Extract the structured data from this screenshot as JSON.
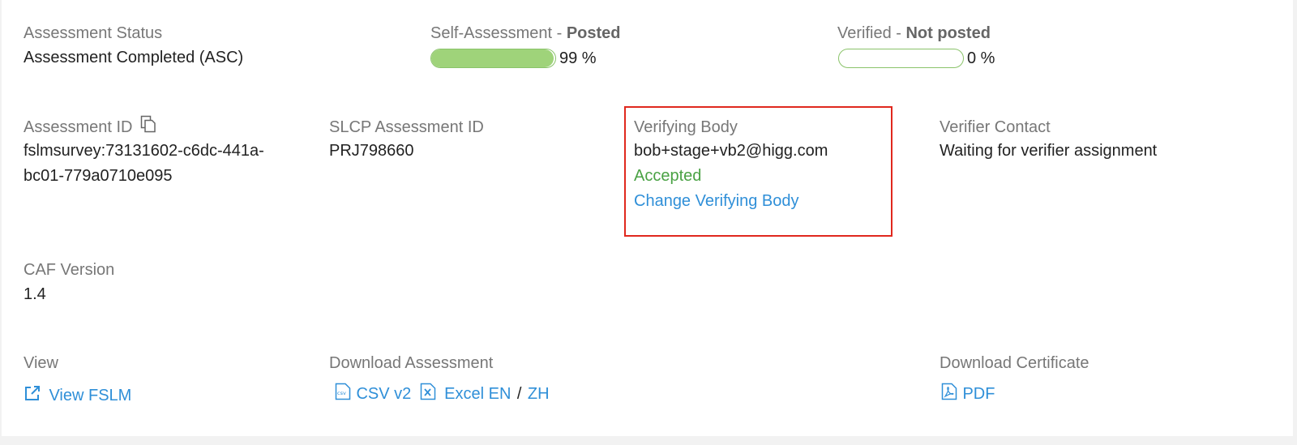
{
  "status": {
    "label": "Assessment Status",
    "value": "Assessment Completed (ASC)"
  },
  "self_assessment": {
    "label": "Self-Assessment - ",
    "state": "Posted",
    "progress": 99,
    "progress_text": "99 %",
    "color": "#9fd37a"
  },
  "verified": {
    "label": "Verified - ",
    "state": "Not posted",
    "progress": 0,
    "progress_text": "0 %"
  },
  "assessment_id": {
    "label": "Assessment ID",
    "icon": "copy-icon",
    "line1": "fslmsurvey:73131602-c6dc-441a-",
    "line2": "bc01-779a0710e095"
  },
  "slcp": {
    "label": "SLCP Assessment ID",
    "value": "PRJ798660"
  },
  "verifying_body": {
    "label": "Verifying Body",
    "email": "bob+stage+vb2@higg.com",
    "status": "Accepted",
    "change_link": "Change Verifying Body",
    "status_color": "#4aa244",
    "highlight_color": "#e0281e"
  },
  "verifier_contact": {
    "label": "Verifier Contact",
    "value": "Waiting for verifier assignment"
  },
  "caf": {
    "label": "CAF Version",
    "value": "1.4"
  },
  "view": {
    "label": "View",
    "link": "View FSLM",
    "icon": "external-link-icon"
  },
  "download_assessment": {
    "label": "Download Assessment",
    "csv_link": "CSV v2",
    "csv_icon_text": "csv",
    "excel_en_link": "Excel EN",
    "separator": "/",
    "excel_zh_link": "ZH"
  },
  "download_certificate": {
    "label": "Download Certificate",
    "pdf_link": "PDF",
    "icon": "pdf-icon"
  },
  "link_color": "#2f8fd8"
}
